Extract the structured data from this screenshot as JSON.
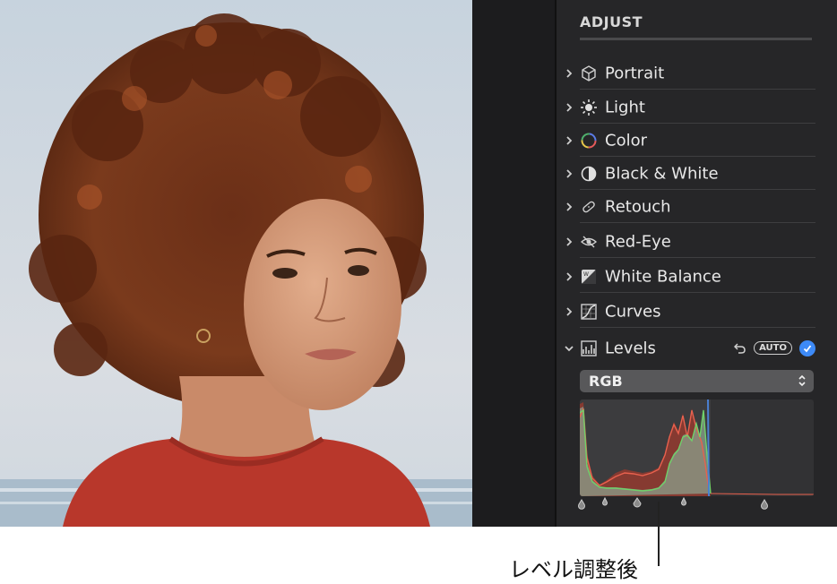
{
  "sidebar": {
    "title": "ADJUST",
    "items": [
      {
        "label": "Portrait",
        "icon": "cube-icon"
      },
      {
        "label": "Light",
        "icon": "sun-icon"
      },
      {
        "label": "Color",
        "icon": "color-wheel-icon"
      },
      {
        "label": "Black & White",
        "icon": "half-circle-icon"
      },
      {
        "label": "Retouch",
        "icon": "bandage-icon"
      },
      {
        "label": "Red-Eye",
        "icon": "eye-slash-icon"
      },
      {
        "label": "White Balance",
        "icon": "white-balance-icon"
      },
      {
        "label": "Curves",
        "icon": "curves-icon"
      }
    ],
    "levels": {
      "label": "Levels",
      "auto_label": "AUTO",
      "channel": "RGB"
    }
  },
  "caption": "レベル調整後",
  "colors": {
    "accent": "#3d8af7",
    "panel": "#262628"
  }
}
